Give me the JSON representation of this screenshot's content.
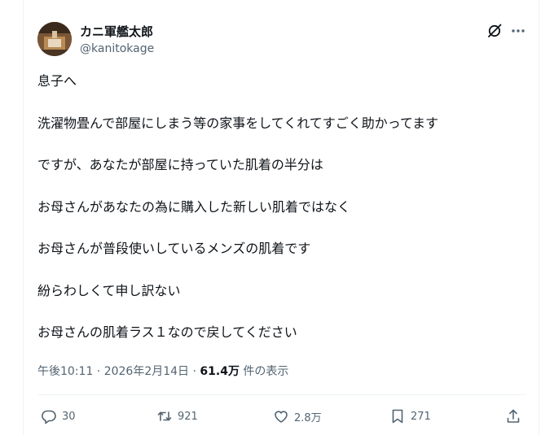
{
  "post": {
    "author": {
      "display_name": "カニ軍艦太郎",
      "handle": "@kanitokage"
    },
    "paragraphs": [
      "息子へ",
      "洗濯物畳んで部屋にしまう等の家事をしてくれてすごく助かってます",
      "ですが、あなたが部屋に持っていた肌着の半分は",
      "お母さんがあなたの為に購入した新しい肌着ではなく",
      "お母さんが普段使いしているメンズの肌着です",
      "紛らわしくて申し訳ない",
      "お母さんの肌着ラス１なので戻してください"
    ],
    "timestamp": "午後10:11 · 2026年2月14日 · ",
    "views_count": "61.4万",
    "views_label": " 件の表示"
  },
  "actions": {
    "replies": "30",
    "reposts": "921",
    "likes": "2.8万",
    "bookmarks": "271"
  },
  "icons": {
    "grok": "grok-icon",
    "more": "more-icon",
    "reply": "reply-icon",
    "repost": "repost-icon",
    "like": "like-icon",
    "bookmark": "bookmark-icon",
    "share": "share-icon"
  },
  "colors": {
    "text": "#0f1419",
    "secondary": "#536471",
    "divider": "#eff3f4"
  }
}
